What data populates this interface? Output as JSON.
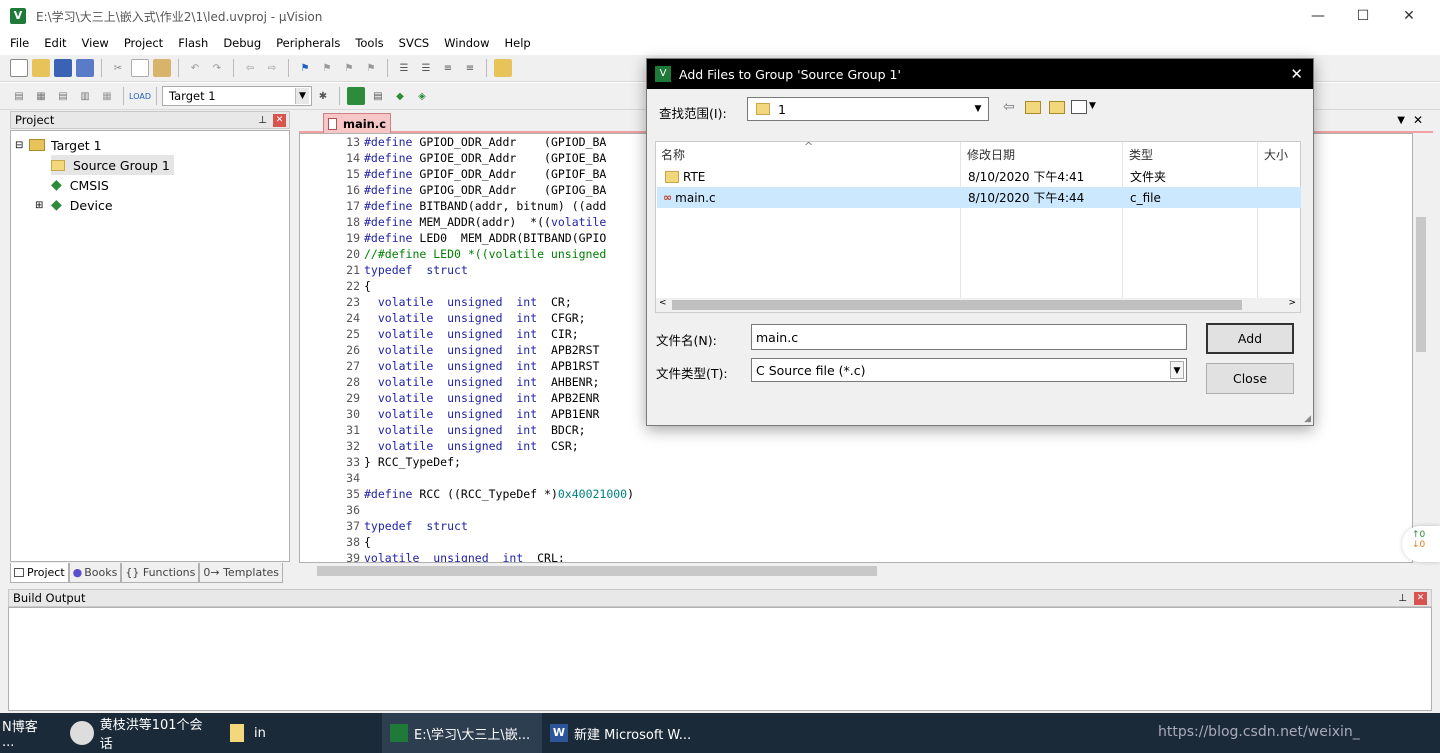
{
  "window": {
    "title": "E:\\学习\\大三上\\嵌入式\\作业2\\1\\led.uvproj - µVision",
    "app_icon": "V",
    "minimize": "—",
    "maximize": "☐",
    "close": "✕"
  },
  "menu": [
    "File",
    "Edit",
    "View",
    "Project",
    "Flash",
    "Debug",
    "Peripherals",
    "Tools",
    "SVCS",
    "Window",
    "Help"
  ],
  "toolbar2": {
    "target": "Target 1"
  },
  "project_panel": {
    "title": "Project",
    "tree": [
      {
        "label": "Target 1",
        "expander": "⊟"
      },
      {
        "label": "Source Group 1",
        "expander": ""
      },
      {
        "label": "CMSIS",
        "expander": ""
      },
      {
        "label": "Device",
        "expander": "⊞"
      }
    ],
    "tabs": [
      "Project",
      "Books",
      "{} Functions",
      "0→ Templates"
    ]
  },
  "editor": {
    "tab": "main.c",
    "lines": [
      {
        "n": "13",
        "segs": [
          [
            "kw",
            "#define"
          ],
          [
            "",
            " GPIOD_ODR_Addr    (GPIOD_BA"
          ]
        ]
      },
      {
        "n": "14",
        "segs": [
          [
            "kw",
            "#define"
          ],
          [
            "",
            " GPIOE_ODR_Addr    (GPIOE_BA"
          ]
        ]
      },
      {
        "n": "15",
        "segs": [
          [
            "kw",
            "#define"
          ],
          [
            "",
            " GPIOF_ODR_Addr    (GPIOF_BA"
          ]
        ]
      },
      {
        "n": "16",
        "segs": [
          [
            "kw",
            "#define"
          ],
          [
            "",
            " GPIOG_ODR_Addr    (GPIOG_BA"
          ]
        ]
      },
      {
        "n": "17",
        "segs": [
          [
            "kw",
            "#define"
          ],
          [
            "",
            " BITBAND(addr, bitnum) ((add"
          ]
        ]
      },
      {
        "n": "18",
        "segs": [
          [
            "kw",
            "#define"
          ],
          [
            "",
            " MEM_ADDR(addr)  *(("
          ],
          [
            "kw",
            "volatile"
          ]
        ]
      },
      {
        "n": "19",
        "segs": [
          [
            "kw",
            "#define"
          ],
          [
            "",
            " LED0  MEM_ADDR(BITBAND(GPIO"
          ]
        ]
      },
      {
        "n": "20",
        "segs": [
          [
            "cm",
            "//#define LED0 *((volatile unsigned"
          ]
        ]
      },
      {
        "n": "21",
        "segs": [
          [
            "kw",
            "typedef"
          ],
          [
            "",
            "  "
          ],
          [
            "kw",
            "struct"
          ]
        ]
      },
      {
        "n": "22",
        "segs": [
          [
            "",
            "{"
          ]
        ]
      },
      {
        "n": "23",
        "segs": [
          [
            "",
            "  "
          ],
          [
            "kw",
            "volatile"
          ],
          [
            "",
            "  "
          ],
          [
            "kw",
            "unsigned"
          ],
          [
            "",
            "  "
          ],
          [
            "kw",
            "int"
          ],
          [
            "",
            "  CR;"
          ]
        ]
      },
      {
        "n": "24",
        "segs": [
          [
            "",
            "  "
          ],
          [
            "kw",
            "volatile"
          ],
          [
            "",
            "  "
          ],
          [
            "kw",
            "unsigned"
          ],
          [
            "",
            "  "
          ],
          [
            "kw",
            "int"
          ],
          [
            "",
            "  CFGR;"
          ]
        ]
      },
      {
        "n": "25",
        "segs": [
          [
            "",
            "  "
          ],
          [
            "kw",
            "volatile"
          ],
          [
            "",
            "  "
          ],
          [
            "kw",
            "unsigned"
          ],
          [
            "",
            "  "
          ],
          [
            "kw",
            "int"
          ],
          [
            "",
            "  CIR;"
          ]
        ]
      },
      {
        "n": "26",
        "segs": [
          [
            "",
            "  "
          ],
          [
            "kw",
            "volatile"
          ],
          [
            "",
            "  "
          ],
          [
            "kw",
            "unsigned"
          ],
          [
            "",
            "  "
          ],
          [
            "kw",
            "int"
          ],
          [
            "",
            "  APB2RST"
          ]
        ]
      },
      {
        "n": "27",
        "segs": [
          [
            "",
            "  "
          ],
          [
            "kw",
            "volatile"
          ],
          [
            "",
            "  "
          ],
          [
            "kw",
            "unsigned"
          ],
          [
            "",
            "  "
          ],
          [
            "kw",
            "int"
          ],
          [
            "",
            "  APB1RST"
          ]
        ]
      },
      {
        "n": "28",
        "segs": [
          [
            "",
            "  "
          ],
          [
            "kw",
            "volatile"
          ],
          [
            "",
            "  "
          ],
          [
            "kw",
            "unsigned"
          ],
          [
            "",
            "  "
          ],
          [
            "kw",
            "int"
          ],
          [
            "",
            "  AHBENR;"
          ]
        ]
      },
      {
        "n": "29",
        "segs": [
          [
            "",
            "  "
          ],
          [
            "kw",
            "volatile"
          ],
          [
            "",
            "  "
          ],
          [
            "kw",
            "unsigned"
          ],
          [
            "",
            "  "
          ],
          [
            "kw",
            "int"
          ],
          [
            "",
            "  APB2ENR"
          ]
        ]
      },
      {
        "n": "30",
        "segs": [
          [
            "",
            "  "
          ],
          [
            "kw",
            "volatile"
          ],
          [
            "",
            "  "
          ],
          [
            "kw",
            "unsigned"
          ],
          [
            "",
            "  "
          ],
          [
            "kw",
            "int"
          ],
          [
            "",
            "  APB1ENR"
          ]
        ]
      },
      {
        "n": "31",
        "segs": [
          [
            "",
            "  "
          ],
          [
            "kw",
            "volatile"
          ],
          [
            "",
            "  "
          ],
          [
            "kw",
            "unsigned"
          ],
          [
            "",
            "  "
          ],
          [
            "kw",
            "int"
          ],
          [
            "",
            "  BDCR;"
          ]
        ]
      },
      {
        "n": "32",
        "segs": [
          [
            "",
            "  "
          ],
          [
            "kw",
            "volatile"
          ],
          [
            "",
            "  "
          ],
          [
            "kw",
            "unsigned"
          ],
          [
            "",
            "  "
          ],
          [
            "kw",
            "int"
          ],
          [
            "",
            "  CSR;"
          ]
        ]
      },
      {
        "n": "33",
        "segs": [
          [
            "",
            "} RCC_TypeDef;"
          ]
        ]
      },
      {
        "n": "34",
        "segs": [
          [
            "",
            ""
          ]
        ]
      },
      {
        "n": "35",
        "segs": [
          [
            "kw",
            "#define"
          ],
          [
            "",
            " RCC ((RCC_TypeDef *)"
          ],
          [
            "num",
            "0x40021000"
          ],
          [
            "",
            ")"
          ]
        ]
      },
      {
        "n": "36",
        "segs": [
          [
            "",
            ""
          ]
        ]
      },
      {
        "n": "37",
        "segs": [
          [
            "kw",
            "typedef"
          ],
          [
            "",
            "  "
          ],
          [
            "kw",
            "struct"
          ]
        ]
      },
      {
        "n": "38",
        "segs": [
          [
            "",
            "{"
          ]
        ]
      },
      {
        "n": "39",
        "segs": [
          [
            "kw",
            "volatile"
          ],
          [
            "",
            "  "
          ],
          [
            "kw",
            "unsigned"
          ],
          [
            "",
            "  "
          ],
          [
            "kw",
            "int"
          ],
          [
            "",
            "  CRL;"
          ]
        ]
      }
    ]
  },
  "build_output": {
    "title": "Build Output"
  },
  "dialog": {
    "title": "Add Files to Group 'Source Group 1'",
    "lookin_label": "查找范围(I):",
    "lookin_value": "1",
    "columns": [
      "名称",
      "修改日期",
      "类型",
      "大小"
    ],
    "files": [
      {
        "name": "RTE",
        "date": "8/10/2020 下午4:41",
        "type": "文件夹",
        "size": ""
      },
      {
        "name": "main.c",
        "date": "8/10/2020 下午4:44",
        "type": "c_file",
        "size": ""
      }
    ],
    "filename_label": "文件名(N):",
    "filename_value": "main.c",
    "filetype_label": "文件类型(T):",
    "filetype_value": "C Source file (*.c)",
    "add_label": "Add",
    "close_label": "Close"
  },
  "taskbar": {
    "items": [
      "N博客 ...",
      "黄枝洪等101个会话",
      "in",
      "E:\\学习\\大三上\\嵌...",
      "新建 Microsoft W..."
    ],
    "watermark": "https://blog.csdn.net/weixin_"
  },
  "net_widget": {
    "up": "↑0",
    "down": "↓0"
  }
}
